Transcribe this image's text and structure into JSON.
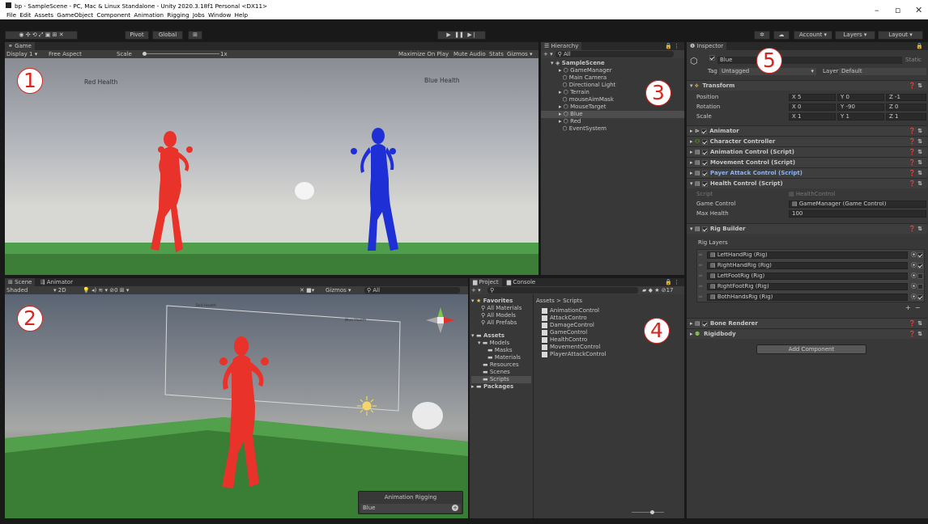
{
  "titlebar": {
    "title": "bp - SampleScene - PC, Mac & Linux Standalone - Unity 2020.3.18f1 Personal <DX11>",
    "menu": [
      "File",
      "Edit",
      "Assets",
      "GameObject",
      "Component",
      "Animation Rigging",
      "Jobs",
      "Window",
      "Help"
    ],
    "minimize": "–",
    "maximize": "▫",
    "close": "✕"
  },
  "toolbar": {
    "pivot": "Pivot",
    "global": "Global",
    "account": "Account",
    "layers": "Layers",
    "layout": "Layout"
  },
  "game": {
    "tab": "Game",
    "display": "Display 1",
    "aspect": "Free Aspect",
    "scale_label": "Scale",
    "scale_value": "1x",
    "maximize": "Maximize On Play",
    "mute": "Mute Audio",
    "stats": "Stats",
    "gizmos": "Gizmos",
    "red_health": "Red Health",
    "blue_health": "Blue Health"
  },
  "scene": {
    "tab_scene": "Scene",
    "tab_animator": "Animator",
    "shading": "Shaded",
    "mode2d": "2D",
    "gizmos": "Gizmos",
    "search": "All",
    "label_left": "Red Health",
    "label_right": "Blue Health",
    "overlay_title": "Animation Rigging",
    "overlay_value": "Blue"
  },
  "hierarchy": {
    "tab": "Hierarchy",
    "search": "All",
    "scene": "SampleScene",
    "items": [
      "GameManager",
      "Main Camera",
      "Directional Light",
      "Terrain",
      "mouseAimMask",
      "MouseTarget",
      "Blue",
      "Red",
      "EventSystem"
    ]
  },
  "project": {
    "tab_project": "Project",
    "tab_console": "Console",
    "count": "17",
    "favorites": "Favorites",
    "fav_items": [
      "All Materials",
      "All Models",
      "All Prefabs"
    ],
    "assets": "Assets",
    "models": "Models",
    "masks": "Masks",
    "materials": "Materials",
    "resources": "Resources",
    "scenes": "Scenes",
    "scripts": "Scripts",
    "packages": "Packages",
    "breadcrumb": "Assets > Scripts",
    "files": [
      "AnimationControl",
      "AttackContro",
      "DamageControl",
      "GameControl",
      "HealthContro",
      "MovementControl",
      "PlayerAttackControl"
    ]
  },
  "inspector": {
    "tab": "Inspector",
    "name": "Blue",
    "static": "Static",
    "tag_label": "Tag",
    "tag": "Untagged",
    "layer_label": "Layer",
    "layer": "Default",
    "transform": "Transform",
    "position": {
      "label": "Position",
      "x": "X 5",
      "y": "Y 0",
      "z": "Z -1"
    },
    "rotation": {
      "label": "Rotation",
      "x": "X 0",
      "y": "Y -90",
      "z": "Z 0"
    },
    "scale": {
      "label": "Scale",
      "x": "X 1",
      "y": "Y 1",
      "z": "Z 1"
    },
    "components": [
      "Animator",
      "Character Controller",
      "Animation Control (Script)",
      "Movement Control (Script)",
      "Payer Attack Control (Script)",
      "Health Control (Script)"
    ],
    "script_label": "Script",
    "script_value": "HealthControl",
    "game_control_label": "Game Control",
    "game_control_value": "GameManager (Game Control)",
    "max_health_label": "Max Health",
    "max_health_value": "100",
    "rig_builder": "Rig Builder",
    "rig_layers": "Rig Layers",
    "rigs": [
      "LeftHandRig (Rig)",
      "RightHandRig (Rig)",
      "LeftFootRig (Rig)",
      "RightFootRig (Rig)",
      "BothHandsRig (Rig)"
    ],
    "bone_renderer": "Bone Renderer",
    "rigidbody": "Rigidbody",
    "add_component": "Add Component"
  },
  "callouts": [
    "1",
    "2",
    "3",
    "4",
    "5"
  ],
  "colors": {
    "red": "#e8322a",
    "blue": "#1e2fd6",
    "accent": "#3e6fd6",
    "callout": "#d7261e"
  }
}
